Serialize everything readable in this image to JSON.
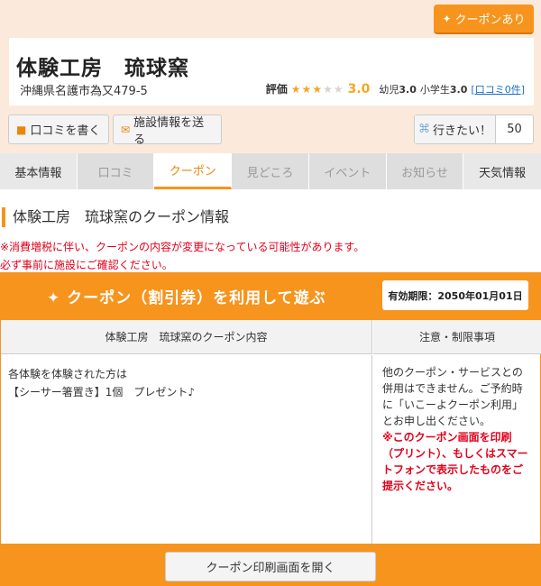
{
  "badge": {
    "label": "クーポンあり"
  },
  "facility": {
    "name": "体験工房　琉球窯",
    "address": "沖縄県名護市為又479-5"
  },
  "rating": {
    "label": "評価",
    "stars_filled": 3,
    "stars_total": 5,
    "score": "3.0",
    "infant_label": "幼児",
    "infant_score": "3.0",
    "elementary_label": "小学生",
    "elementary_score": "3.0",
    "reviews_link": "[口コミ0件]"
  },
  "actions": {
    "write_review": "口コミを書く",
    "send_info": "施設情報を送る",
    "want_to_go": "行きたい！",
    "want_count": "50"
  },
  "tabs": [
    "基本情報",
    "口コミ",
    "クーポン",
    "見どころ",
    "イベント",
    "お知らせ",
    "天気情報"
  ],
  "active_tab": "クーポン",
  "section_title": "体験工房　琉球窯のクーポン情報",
  "notices": [
    "※消費増税に伴い、クーポンの内容が変更になっている可能性があります。",
    "必ず事前に施設にご確認ください。"
  ],
  "coupon": {
    "band_title": "クーポン（割引券）を利用して遊ぶ",
    "expiry": "有効期限：2050年01月01日",
    "col_content": "体験工房　琉球窯のクーポン内容",
    "col_restrictions": "注意・制限事項",
    "content_line1": "各体験を体験された方は",
    "content_line2": "【シーサー箸置き】1個　プレゼント♪",
    "restriction_text": "他のクーポン・サービスとの併用はできません。ご予約時に「いこーよクーポン利用」とお申し出ください。",
    "restriction_warning": "※このクーポン画面を印刷（プリント）、もしくはスマートフォンで表示したものをご提示ください。"
  },
  "print_button": "クーポン印刷画面を開く",
  "colors": {
    "accent": "#f7941d",
    "warning": "#e3001b",
    "link": "#1a6fc9",
    "star": "#f5a623"
  }
}
